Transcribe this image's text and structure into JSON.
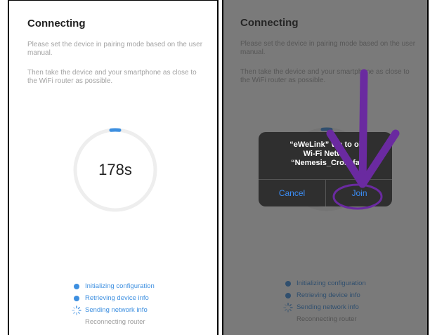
{
  "left": {
    "title": "Connecting",
    "desc1": "Please set the device in pairing mode based on the user manual.",
    "desc2": "Then take the device and your smartphone as close to the WiFi router as possible.",
    "countdown": "178s",
    "steps": [
      {
        "label": "Initializing configuration",
        "state": "done"
      },
      {
        "label": "Retrieving device info",
        "state": "done"
      },
      {
        "label": "Sending network info",
        "state": "loading"
      },
      {
        "label": "Reconnecting router",
        "state": "pending"
      }
    ]
  },
  "right": {
    "title": "Connecting",
    "desc1": "Please set the device in pairing mode based on the user manual.",
    "desc2": "Then take the device and your smartphone as close to the WiFi router as possible.",
    "dialog": {
      "line1": "“eWeLink” Wa",
      "line1b": "to",
      "line1c": "oi",
      "line2": "Wi-Fi Netwo",
      "line3": "“Nemesis_Crossfa",
      "cancel": "Cancel",
      "join": "Join"
    },
    "steps": [
      {
        "label": "Initializing configuration",
        "state": "done"
      },
      {
        "label": "Retrieving device info",
        "state": "done"
      },
      {
        "label": "Sending network info",
        "state": "loading"
      },
      {
        "label": "Reconnecting router",
        "state": "pending"
      }
    ]
  },
  "colors": {
    "accent": "#3d8fe0",
    "ring": "#eeeeee",
    "annotation": "#6a2aa0"
  }
}
